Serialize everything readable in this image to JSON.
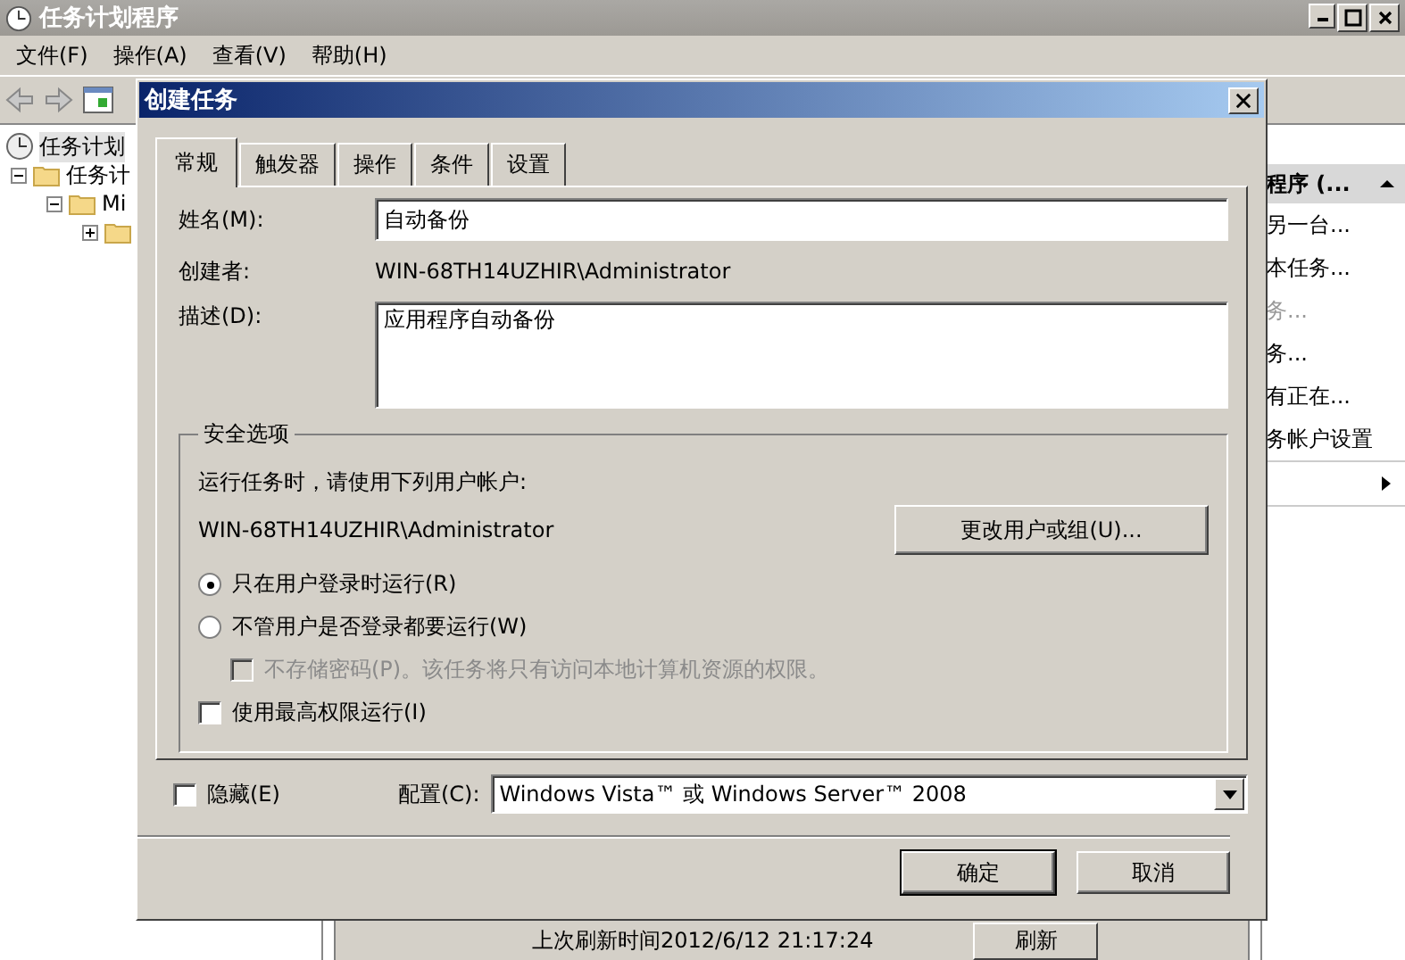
{
  "window": {
    "title": "任务计划程序"
  },
  "menu": [
    "文件(F)",
    "操作(A)",
    "查看(V)",
    "帮助(H)"
  ],
  "tree": [
    {
      "label": "任务计划",
      "selected": true,
      "children": [
        {
          "label": "任务计",
          "selected": false,
          "expanded": true,
          "children": [
            {
              "label": "Mi",
              "selected": false,
              "expanded": true,
              "children": [
                {
                  "expanded": false
                }
              ]
            }
          ]
        }
      ]
    }
  ],
  "actions": {
    "header": "程序 (...",
    "items": [
      {
        "label": "另一台...",
        "disabled": false
      },
      {
        "label": "本任务...",
        "disabled": false
      },
      {
        "label": "务...",
        "disabled": true
      },
      {
        "label": "务...",
        "disabled": false
      },
      {
        "label": "有正在...",
        "disabled": false
      },
      {
        "label": "务帐户设置",
        "disabled": false
      }
    ]
  },
  "background": {
    "refresh_text": "上次刷新时间2012/6/12 21:17:24",
    "refresh_button": "刷新"
  },
  "dialog": {
    "title": "创建任务",
    "tabs": [
      {
        "label": "常规",
        "selected": true
      },
      {
        "label": "触发器",
        "selected": false
      },
      {
        "label": "操作",
        "selected": false
      },
      {
        "label": "条件",
        "selected": false
      },
      {
        "label": "设置",
        "selected": false
      }
    ],
    "name": {
      "label": "姓名(M):",
      "value": "自动备份"
    },
    "author": {
      "label": "创建者:",
      "value": "WIN-68TH14UZHIR\\Administrator"
    },
    "description": {
      "label": "描述(D):",
      "value": "应用程序自动备份"
    },
    "security": {
      "legend": "安全选项",
      "prompt": "运行任务时，请使用下列用户帐户:",
      "account": "WIN-68TH14UZHIR\\Administrator",
      "change_button": "更改用户或组(U)...",
      "radios": [
        {
          "label": "只在用户登录时运行(R)",
          "selected": true
        },
        {
          "label": "不管用户是否登录都要运行(W)",
          "selected": false
        }
      ],
      "no_password": {
        "label": "不存储密码(P)。该任务将只有访问本地计算机资源的权限。",
        "checked": false,
        "disabled": true
      },
      "highest": {
        "label": "使用最高权限运行(I)",
        "checked": false
      }
    },
    "hidden": {
      "label": "隐藏(E)",
      "checked": false
    },
    "config": {
      "label": "配置(C):",
      "value": "Windows Vista™ 或 Windows Server™ 2008"
    },
    "buttons": [
      "确定",
      "取消"
    ]
  }
}
